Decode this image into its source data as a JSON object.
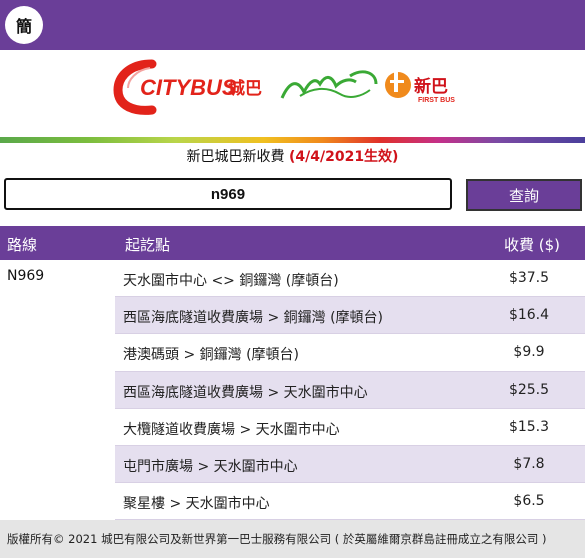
{
  "header": {
    "lang_toggle": "簡",
    "color": "#6a3e98"
  },
  "logos": {
    "citybus_text": "CITYBUS",
    "citybus_cn": "城巴",
    "nwfb_cn": "新巴",
    "nwfb_en": "FIRST BUS"
  },
  "notice": {
    "prefix": "新巴城巴新收費 ",
    "effective": "(4/4/2021生效)"
  },
  "search": {
    "value": "n969",
    "button_label": "查詢"
  },
  "table": {
    "headers": {
      "route": "路線",
      "stops": "起訖點",
      "fare": "收費 ($)"
    },
    "route": "N969",
    "rows": [
      {
        "stops": "天水圍市中心 <> 銅鑼灣 (摩頓台)",
        "fare": "$37.5"
      },
      {
        "stops": "西區海底隧道收費廣場 > 銅鑼灣 (摩頓台)",
        "fare": "$16.4"
      },
      {
        "stops": "港澳碼頭 > 銅鑼灣 (摩頓台)",
        "fare": "$9.9"
      },
      {
        "stops": "西區海底隧道收費廣場 > 天水圍市中心",
        "fare": "$25.5"
      },
      {
        "stops": "大欖隧道收費廣場 > 天水圍市中心",
        "fare": "$15.3"
      },
      {
        "stops": "屯門市廣場 > 天水圍市中心",
        "fare": "$7.8"
      },
      {
        "stops": "聚星樓 > 天水圍市中心",
        "fare": "$6.5"
      }
    ]
  },
  "footer": {
    "text": "版權所有© 2021 城巴有限公司及新世界第一巴士服務有限公司 ( 於英屬維爾京群島註冊成立之有限公司 )"
  }
}
